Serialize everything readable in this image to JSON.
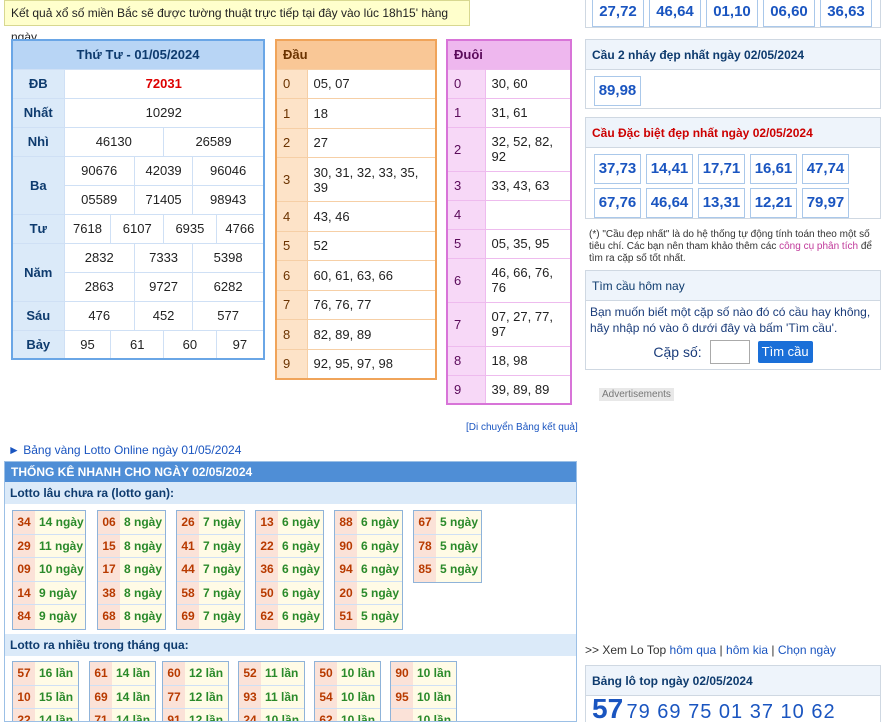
{
  "notice": "Kết quả xổ số miền Bắc sẽ được tường thuật trực tiếp tại đây vào lúc 18h15' hàng ngày.",
  "results": {
    "title": "Thứ Tư - 01/05/2024",
    "labels": [
      "ĐB",
      "Nhất",
      "Nhì",
      "Ba",
      "Tư",
      "Năm",
      "Sáu",
      "Bảy"
    ],
    "db": "72031",
    "nhat": "10292",
    "nhi": [
      "46130",
      "26589"
    ],
    "ba": [
      "90676",
      "42039",
      "96046",
      "05589",
      "71405",
      "98943"
    ],
    "tu": [
      "7618",
      "6107",
      "6935",
      "4766"
    ],
    "nam": [
      "2832",
      "7333",
      "5398",
      "2863",
      "9727",
      "6282"
    ],
    "sau": [
      "476",
      "452",
      "577"
    ],
    "bay": [
      "95",
      "61",
      "60",
      "97"
    ]
  },
  "dau": {
    "title": "Đầu",
    "keys": [
      "0",
      "1",
      "2",
      "3",
      "4",
      "5",
      "6",
      "7",
      "8",
      "9"
    ],
    "vals": [
      "05, 07",
      "18",
      "27",
      "30, 31, 32, 33, 35, 39",
      "43, 46",
      "52",
      "60, 61, 63, 66",
      "76, 76, 77",
      "82, 89, 89",
      "92, 95, 97, 98"
    ]
  },
  "duoi": {
    "title": "Đuôi",
    "keys": [
      "0",
      "1",
      "2",
      "3",
      "4",
      "5",
      "6",
      "7",
      "8",
      "9"
    ],
    "vals": [
      "30, 60",
      "31, 61",
      "32, 52, 82, 92",
      "33, 43, 63",
      "",
      "05, 35, 95",
      "46, 66, 76, 76",
      "07, 27, 77, 97",
      "18, 98",
      "39, 89, 89"
    ]
  },
  "top_chips": [
    "27,72",
    "46,64",
    "01,10",
    "06,60",
    "36,63"
  ],
  "cau2": {
    "title": "Cầu 2 nháy đẹp nhất ngày 02/05/2024",
    "chips": [
      "89,98"
    ]
  },
  "caudb": {
    "title": "Cầu Đặc biệt đẹp nhất ngày 02/05/2024",
    "row1": [
      "37,73",
      "14,41",
      "17,71",
      "16,61",
      "47,74"
    ],
    "row2": [
      "67,76",
      "46,64",
      "13,31",
      "12,21",
      "79,97"
    ]
  },
  "note": {
    "prefix": "(*) \"Cầu đẹp nhất\" là do hệ thống tự động tính toán theo một số tiêu chí. Các bạn nên tham khảo thêm các ",
    "link": "công cụ phân tích",
    "suffix": " để tìm ra cặp số tốt nhất."
  },
  "timcau": {
    "title": "Tìm cầu hôm nay",
    "desc": "Bạn muốn biết một cặp số nào đó có cầu hay không, hãy nhập nó vào ô dưới đây và bấm 'Tìm cầu'.",
    "label": "Cặp số:",
    "button": "Tìm cầu"
  },
  "ads": "Advertisements",
  "move_link": "[Di chuyển Bảng kết quả]",
  "bang_vang": "► Bảng vàng Lotto Online ngày 01/05/2024",
  "stats_title": "THỐNG KÊ NHANH CHO NGÀY 02/05/2024",
  "gan_title": "Lotto lâu chưa ra (lotto gan):",
  "gan": [
    [
      [
        "34",
        "14 ngày"
      ],
      [
        "29",
        "11 ngày"
      ],
      [
        "09",
        "10 ngày"
      ],
      [
        "14",
        "9 ngày"
      ],
      [
        "84",
        "9 ngày"
      ]
    ],
    [
      [
        "06",
        "8 ngày"
      ],
      [
        "15",
        "8 ngày"
      ],
      [
        "17",
        "8 ngày"
      ],
      [
        "38",
        "8 ngày"
      ],
      [
        "68",
        "8 ngày"
      ]
    ],
    [
      [
        "26",
        "7 ngày"
      ],
      [
        "41",
        "7 ngày"
      ],
      [
        "44",
        "7 ngày"
      ],
      [
        "58",
        "7 ngày"
      ],
      [
        "69",
        "7 ngày"
      ]
    ],
    [
      [
        "13",
        "6 ngày"
      ],
      [
        "22",
        "6 ngày"
      ],
      [
        "36",
        "6 ngày"
      ],
      [
        "50",
        "6 ngày"
      ],
      [
        "62",
        "6 ngày"
      ]
    ],
    [
      [
        "88",
        "6 ngày"
      ],
      [
        "90",
        "6 ngày"
      ],
      [
        "94",
        "6 ngày"
      ],
      [
        "20",
        "5 ngày"
      ],
      [
        "51",
        "5 ngày"
      ]
    ],
    [
      [
        "67",
        "5 ngày"
      ],
      [
        "78",
        "5 ngày"
      ],
      [
        "85",
        "5 ngày"
      ]
    ]
  ],
  "nhieu_title": "Lotto ra nhiều trong tháng qua:",
  "nhieu": [
    [
      [
        "57",
        "16 lần"
      ],
      [
        "10",
        "15 lần"
      ],
      [
        "22",
        "14 lần"
      ]
    ],
    [
      [
        "61",
        "14 lần"
      ],
      [
        "69",
        "14 lần"
      ],
      [
        "71",
        "14 lần"
      ]
    ],
    [
      [
        "60",
        "12 lần"
      ],
      [
        "77",
        "12 lần"
      ],
      [
        "91",
        "12 lần"
      ]
    ],
    [
      [
        "52",
        "11 lần"
      ],
      [
        "93",
        "11 lần"
      ],
      [
        "24",
        "10 lần"
      ]
    ],
    [
      [
        "50",
        "10 lần"
      ],
      [
        "54",
        "10 lần"
      ],
      [
        "62",
        "10 lần"
      ]
    ],
    [
      [
        "90",
        "10 lần"
      ],
      [
        "95",
        "10 lần"
      ],
      [
        "",
        "10 lần"
      ]
    ]
  ],
  "xemlo": {
    "prefix": ">> Xem Lo Top ",
    "l1": "hôm qua",
    "l2": "hôm kia",
    "l3": "Chọn ngày"
  },
  "lotop": {
    "title": "Bảng lô top ngày 02/05/2024",
    "big": "57",
    "rest": "79 69 75 01 37 10 62"
  }
}
